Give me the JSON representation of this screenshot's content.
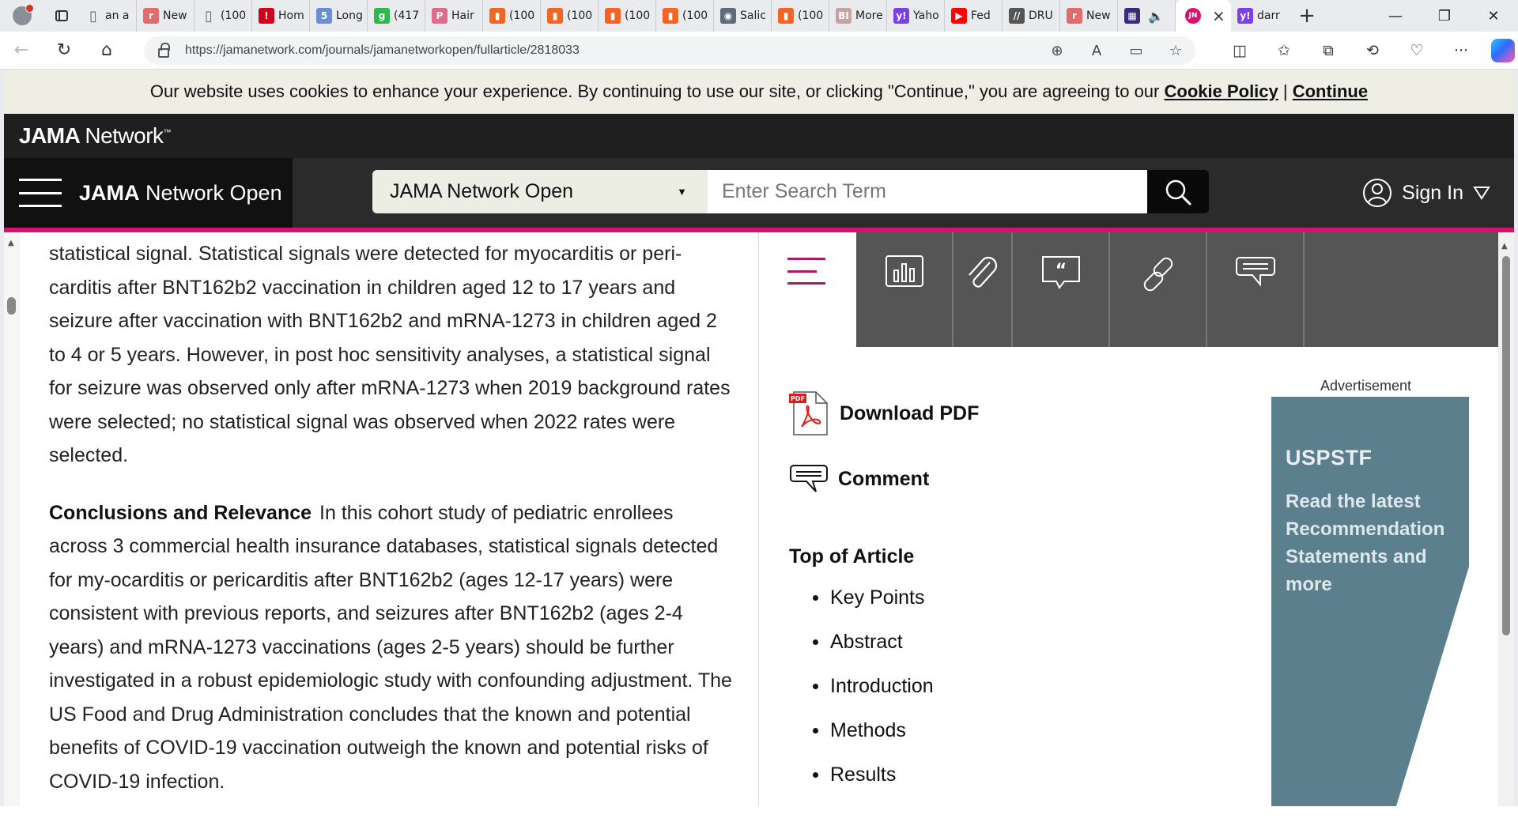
{
  "browser": {
    "tabs": [
      {
        "label": "an a",
        "icon": "page-icon",
        "color": "#666666"
      },
      {
        "label": "New",
        "icon": "r-icon",
        "color": "#e06c6c"
      },
      {
        "label": "(100",
        "icon": "page-icon",
        "color": "#666666"
      },
      {
        "label": "Hom",
        "icon": "red-shield-icon",
        "color": "#d0021b"
      },
      {
        "label": "Long",
        "icon": "five-icon",
        "color": "#6b8fd6"
      },
      {
        "label": "(417",
        "icon": "g-icon",
        "color": "#2db84d"
      },
      {
        "label": "Hair",
        "icon": "p-icon",
        "color": "#e06c8c"
      },
      {
        "label": "(100",
        "icon": "bookmark-icon",
        "color": "#f26522"
      },
      {
        "label": "(100",
        "icon": "bookmark-icon",
        "color": "#f26522"
      },
      {
        "label": "(100",
        "icon": "bookmark-icon",
        "color": "#f26522"
      },
      {
        "label": "(100",
        "icon": "bookmark-icon",
        "color": "#f26522"
      },
      {
        "label": "Salic",
        "icon": "circle-icon",
        "color": "#5f6b7a"
      },
      {
        "label": "(100",
        "icon": "bookmark-icon",
        "color": "#f26522"
      },
      {
        "label": "More",
        "icon": "bi-icon",
        "color": "#c9a2a2"
      },
      {
        "label": "Yaho",
        "icon": "yahoo-icon",
        "color": "#7b3fe4"
      },
      {
        "label": "Fed",
        "icon": "youtube-icon",
        "color": "#ff0000"
      },
      {
        "label": "DRU",
        "icon": "stripes-icon",
        "color": "#555555"
      },
      {
        "label": "New",
        "icon": "r-icon",
        "color": "#e06c6c"
      },
      {
        "label": "",
        "icon": "media-icon",
        "color": "#3a2a7a"
      }
    ],
    "active_tab": {
      "icon_text": "JN",
      "color": "#d5126f"
    },
    "after_tab": {
      "label": "darr",
      "icon": "yahoo-icon",
      "color": "#7b3fe4"
    },
    "url": "https://jamanetwork.com/journals/jamanetworkopen/fullarticle/2818033"
  },
  "cookie_banner": {
    "text": "Our website uses cookies to enhance your experience. By continuing to use our site, or clicking \"Continue,\" you are agreeing to our ",
    "policy_link": "Cookie Policy",
    "separator": " | ",
    "continue_link": "Continue"
  },
  "header": {
    "network_bold": "JAMA",
    "network_rest": "Network",
    "tm": "™",
    "journal_bold": "JAMA",
    "journal_rest": " Network Open",
    "search_scope": "JAMA Network Open",
    "search_placeholder": "Enter Search Term",
    "signin": "Sign In"
  },
  "article": {
    "para1": "statistical signal. Statistical signals were detected for myocarditis or peri-carditis after BNT162b2 vaccination in children aged 12 to 17 years and seizure after vaccination with BNT162b2 and mRNA-1273 in children aged 2 to 4 or 5 years. However, in post hoc sensitivity analyses, a statistical signal for seizure was observed only after mRNA-1273 when 2019 background rates were selected; no statistical signal was observed when 2022 rates were selected.",
    "conclusions_heading": "Conclusions and Relevance",
    "conclusions_text": "In this cohort study of pediatric enrollees across 3 commercial health insurance databases, statistical signals detected for my-ocarditis or pericarditis after BNT162b2 (ages 12-17 years) were consistent with previous reports, and seizures after BNT162b2 (ages 2-4 years) and mRNA-1273 vaccinations (ages 2-5 years) should be further investigated in a robust epidemiologic study with confounding adjustment. The US Food and Drug Administration concludes that the known and potential benefits of COVID-19 vaccination outweigh the known and potential risks of COVID-19 infection."
  },
  "sidebar": {
    "download_pdf": "Download PDF",
    "comment": "Comment",
    "toc_title": "Top of Article",
    "toc_items": [
      "Key Points",
      "Abstract",
      "Introduction",
      "Methods",
      "Results"
    ],
    "ad_label": "Advertisement",
    "ad_heading": "USPSTF",
    "ad_body": "Read the latest Recommendation Statements and more"
  },
  "colors": {
    "jama_pink": "#d5126f",
    "ad_teal": "#5b7f8c"
  }
}
